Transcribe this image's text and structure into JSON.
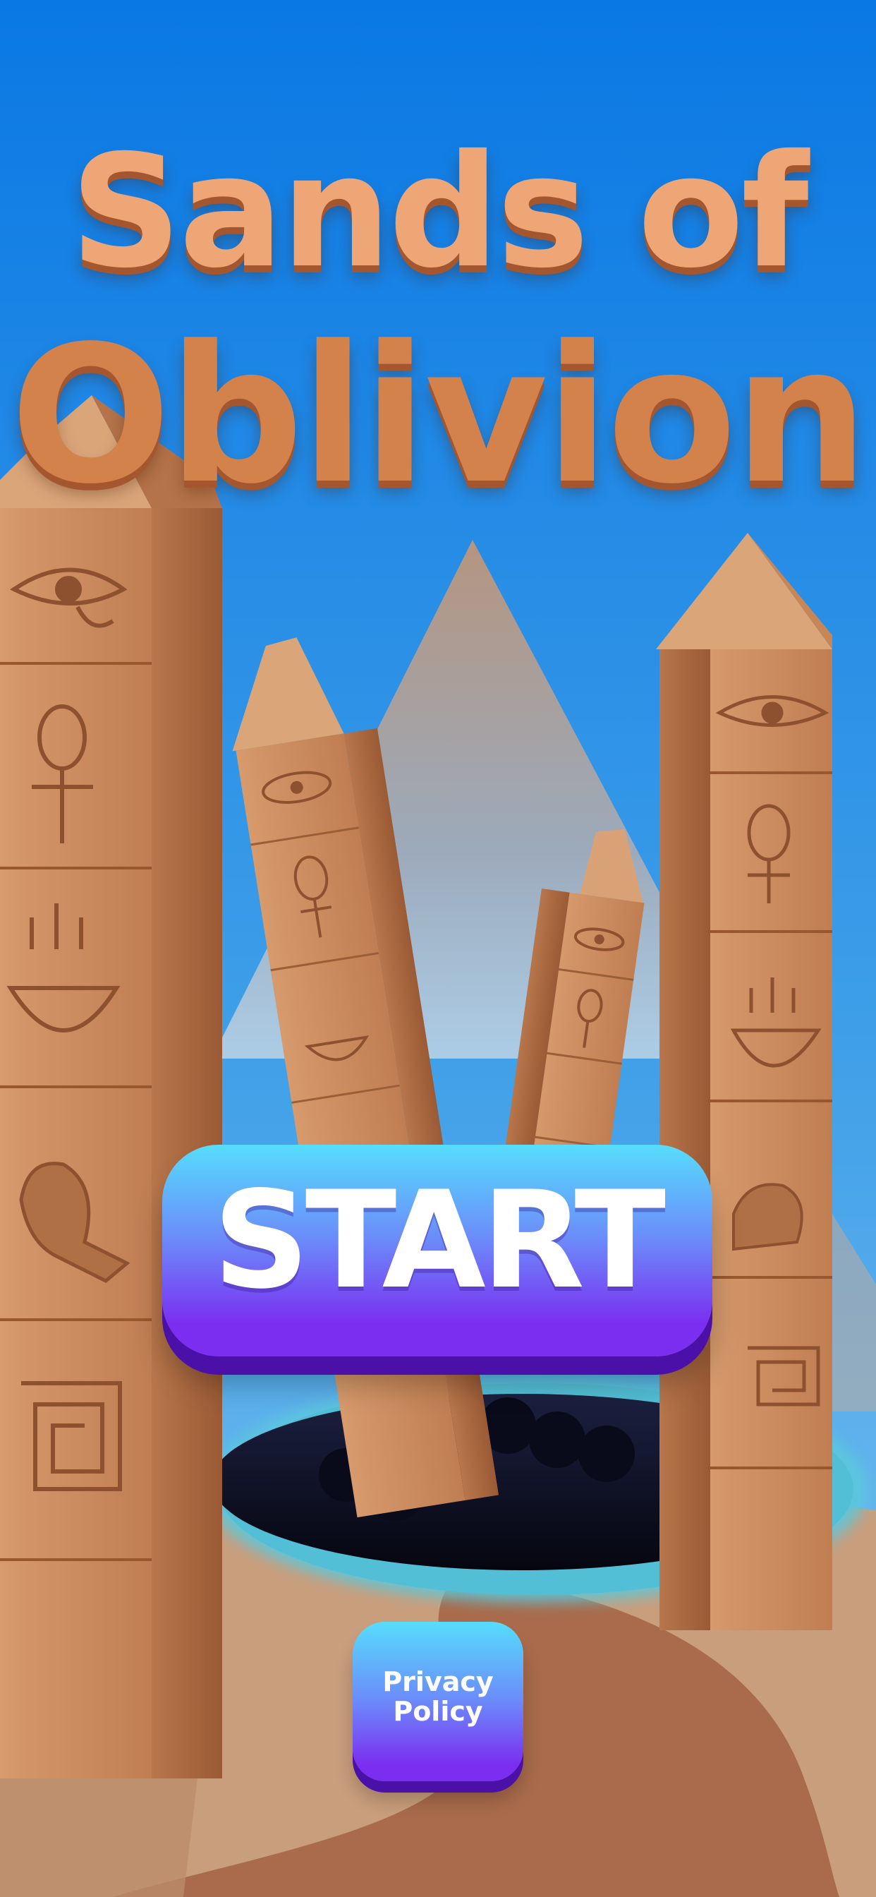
{
  "game": {
    "title_line1": "Sands of",
    "title_line2": "Oblivion"
  },
  "buttons": {
    "start_label": "START",
    "privacy_label": "Privacy Policy"
  },
  "colors": {
    "sky_top": "#0a78e4",
    "sky_bottom": "#7cc2f2",
    "sand_light": "#c79a74",
    "sand_dark": "#a9704f",
    "stone": "#c98a5e",
    "portal_ring": "#5bc8dc",
    "portal_hole": "#0b0c22",
    "button_top": "#56ddfc",
    "button_bottom": "#7a2ef0",
    "title": "#e9a06c"
  },
  "icons": {
    "glyphs": [
      "eye-of-horus-icon",
      "ankh-icon",
      "bowl-glyph-icon",
      "bird-glyph-icon",
      "spiral-glyph-icon"
    ]
  }
}
